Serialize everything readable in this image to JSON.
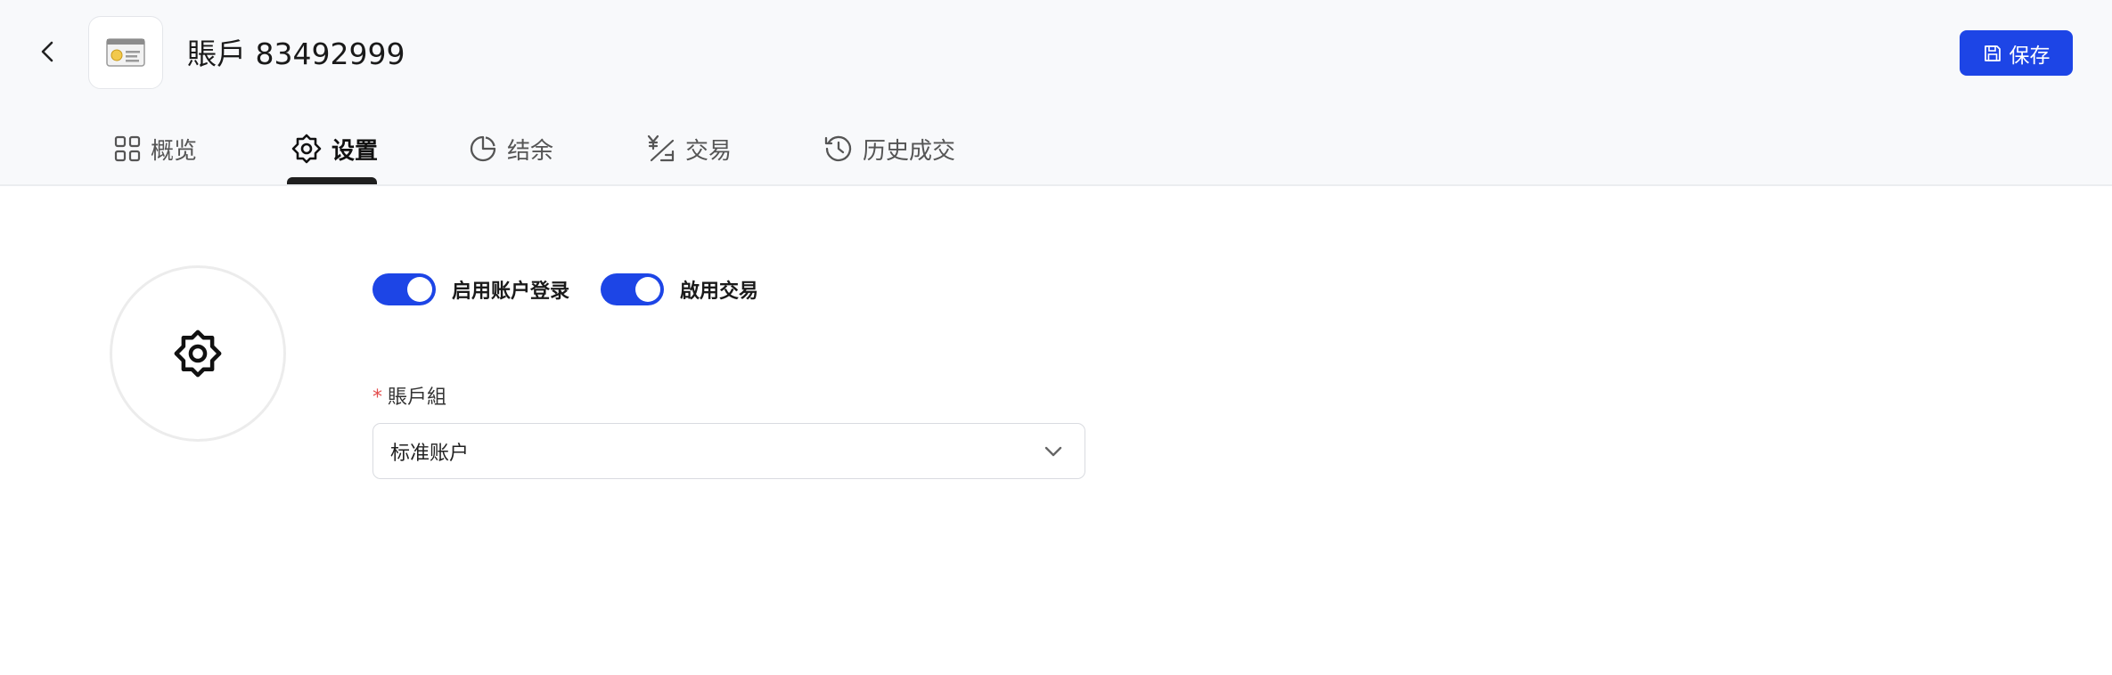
{
  "header": {
    "title": "賬戶 83492999",
    "save_label": "保存",
    "icons": {
      "back": "chevron-left-icon",
      "account": "id-card-icon",
      "save": "floppy-disk-icon"
    }
  },
  "tabs": [
    {
      "label": "概览",
      "icon": "grid-icon",
      "active": false
    },
    {
      "label": "设置",
      "icon": "gear-icon",
      "active": true
    },
    {
      "label": "结余",
      "icon": "pie-chart-icon",
      "active": false
    },
    {
      "label": "交易",
      "icon": "yen-exchange-icon",
      "active": false
    },
    {
      "label": "历史成交",
      "icon": "history-icon",
      "active": false
    }
  ],
  "settings": {
    "avatar_icon": "gear-icon",
    "toggles": [
      {
        "label": "启用账户登录",
        "on": true
      },
      {
        "label": "啟用交易",
        "on": true
      }
    ],
    "account_group": {
      "label": "賬戶組",
      "required_mark": "*",
      "value": "标准账户"
    }
  },
  "colors": {
    "accent": "#1d45e6",
    "header_bg": "#f8f9fb",
    "required": "#e34d4d"
  }
}
